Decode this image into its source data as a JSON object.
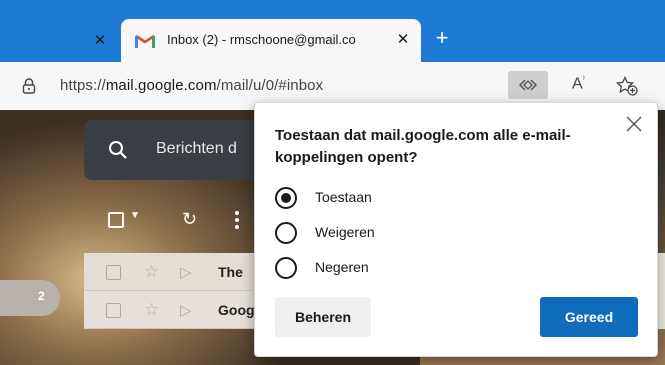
{
  "browser": {
    "tab": {
      "title": "Inbox (2) - rmschoone@gmail.co",
      "favicon": "gmail-icon"
    },
    "address": {
      "protocol": "https://",
      "host": "mail.google.com",
      "path": "/mail/u/0/#inbox"
    },
    "readaloud_label": "A⁾"
  },
  "gmail": {
    "search_placeholder": "Berichten d",
    "unread_badge": "2",
    "rows": [
      {
        "sender": "The"
      },
      {
        "sender": "Goog"
      }
    ]
  },
  "dialog": {
    "title": "Toestaan dat mail.google.com alle e-mail-koppelingen opent?",
    "options": [
      {
        "label": "Toestaan",
        "selected": true
      },
      {
        "label": "Weigeren",
        "selected": false
      },
      {
        "label": "Negeren",
        "selected": false
      }
    ],
    "manage_label": "Beheren",
    "done_label": "Gereed"
  },
  "colors": {
    "tabstrip": "#1f7ad6",
    "primary_button": "#0f6cbd"
  }
}
